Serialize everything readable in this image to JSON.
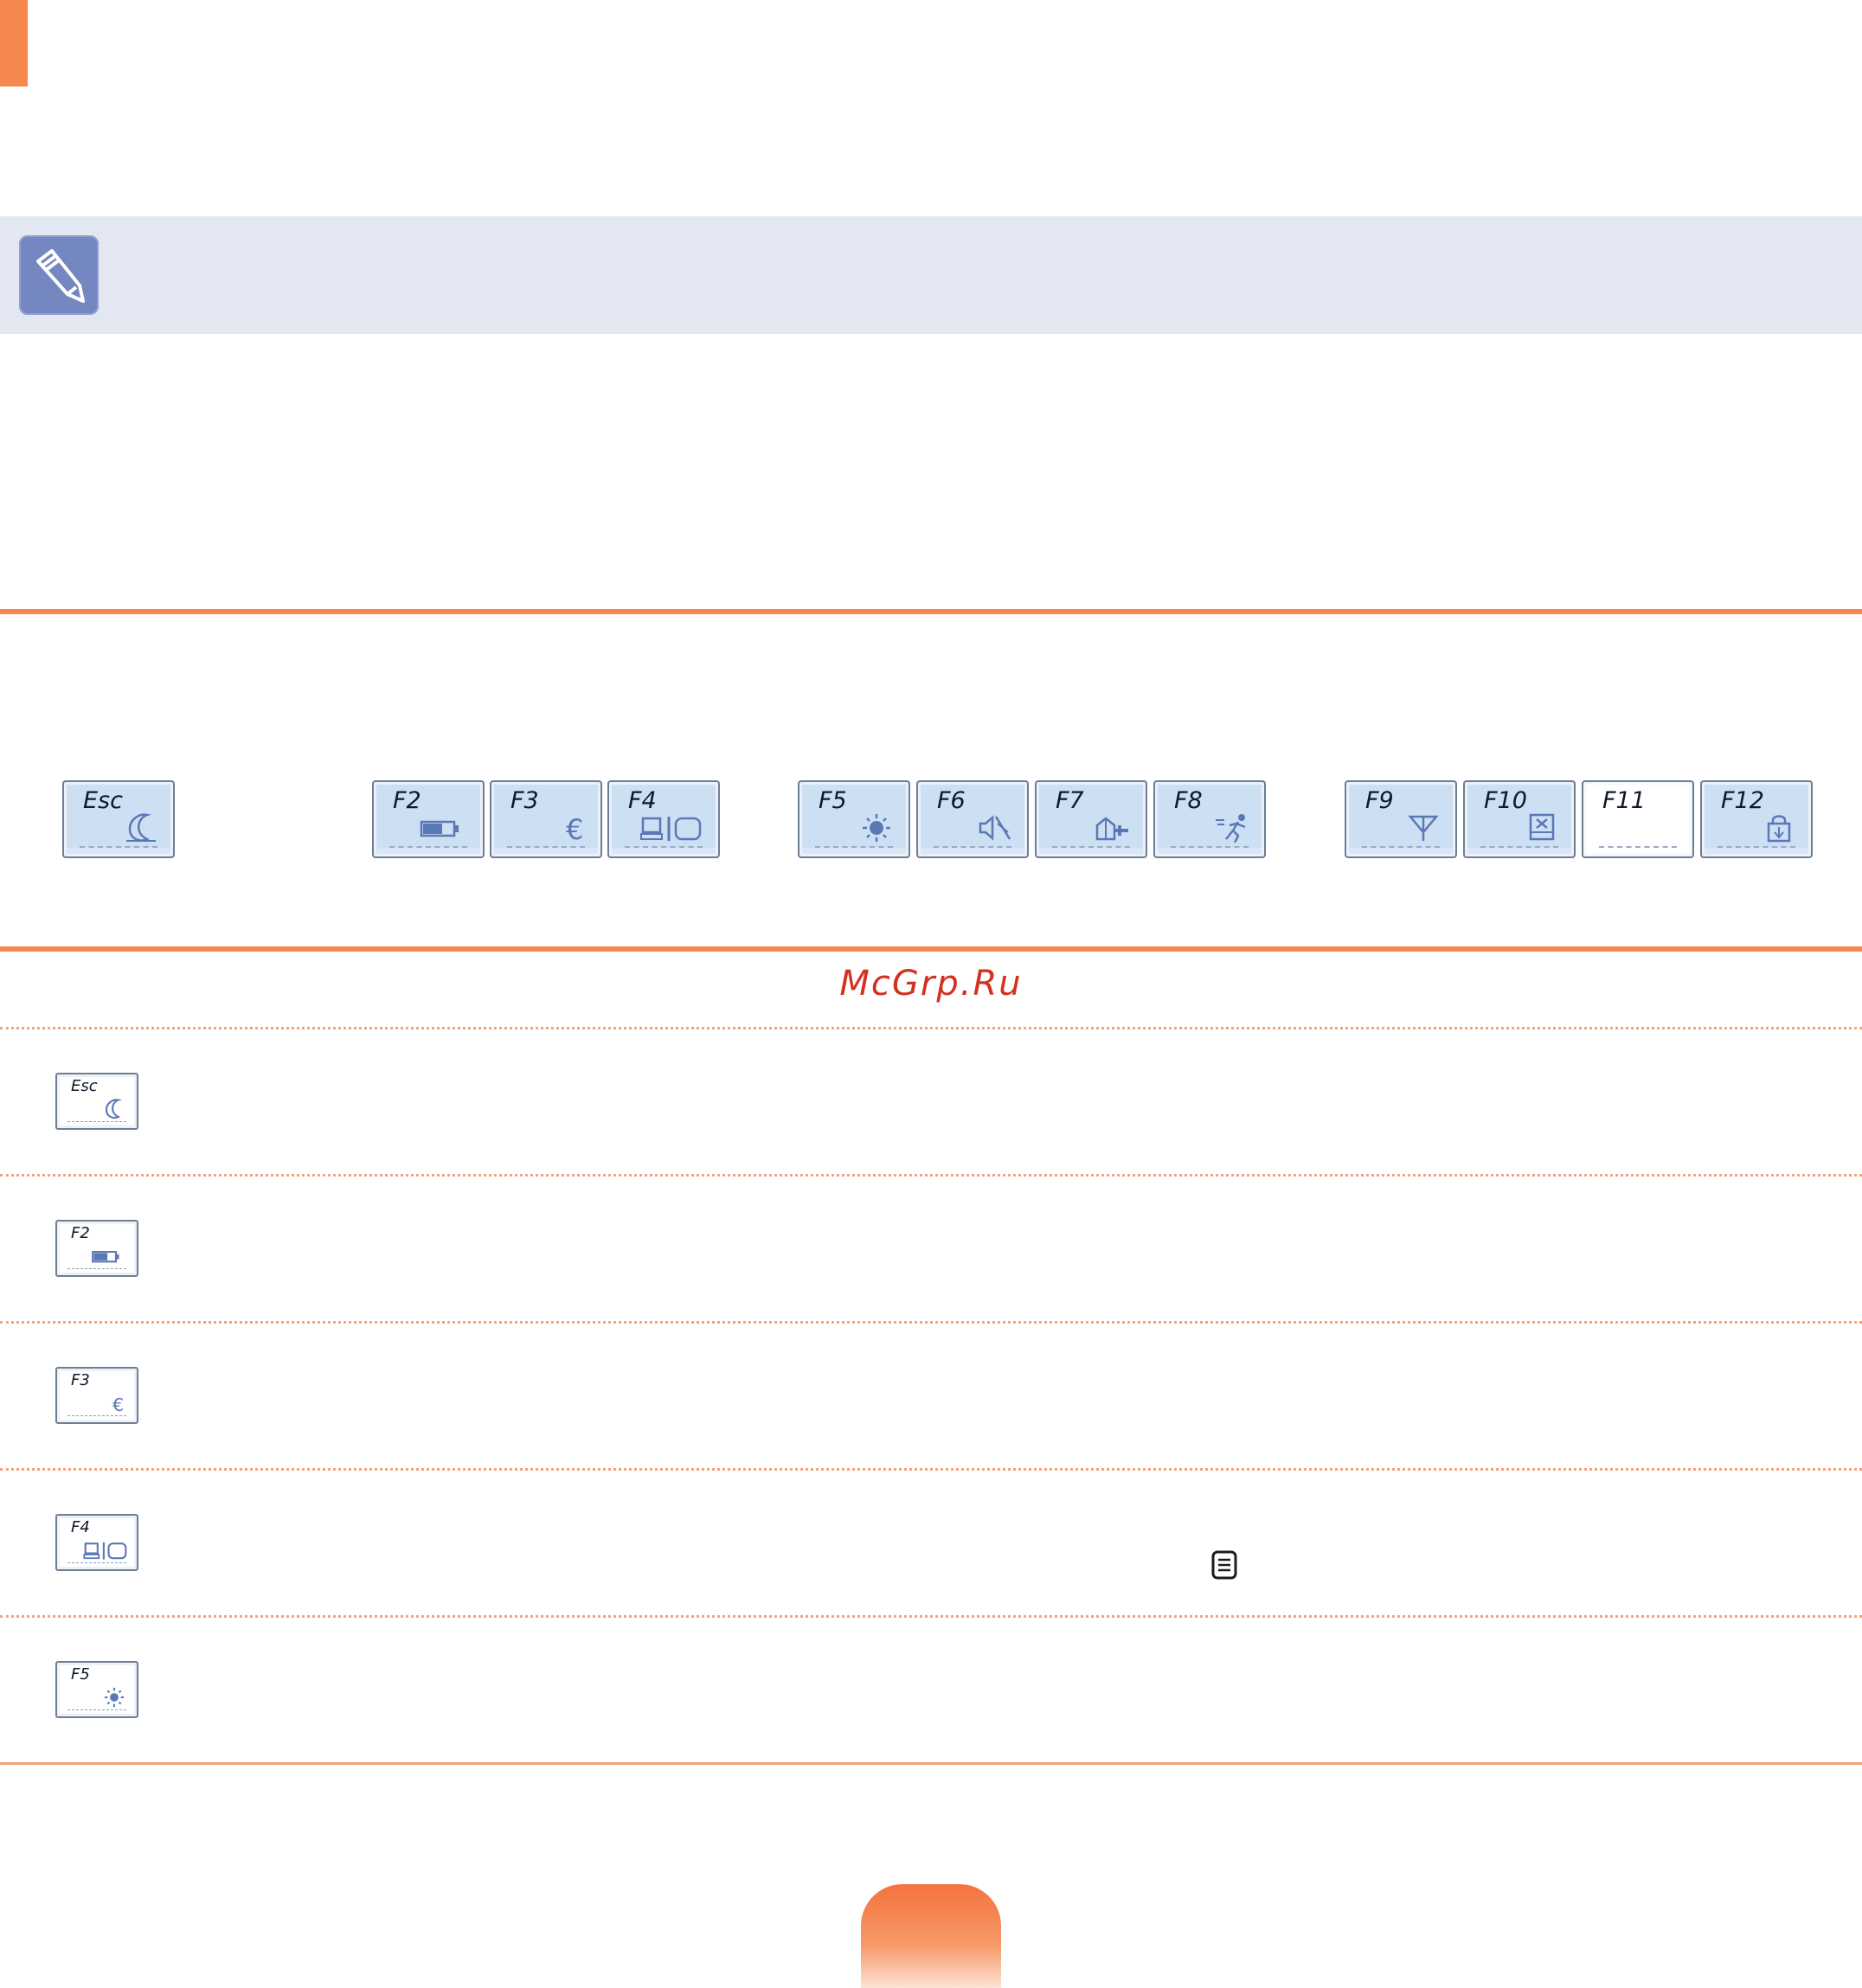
{
  "page": {
    "accent_color": "#f4884f",
    "note_band_color": "#e2e7f1",
    "watermark": "McGrp.Ru"
  },
  "icons": {
    "note": "pencil-note-icon",
    "memo": "memo-icon"
  },
  "keyboard_row": [
    {
      "key": "Esc",
      "icon": "moon-icon"
    },
    {
      "key": "F2",
      "icon": "battery-icon"
    },
    {
      "key": "F3",
      "icon": "euro-icon"
    },
    {
      "key": "F4",
      "icon": "lcd-crt-icon"
    },
    {
      "key": "F5",
      "icon": "brightness-icon"
    },
    {
      "key": "F6",
      "icon": "mute-icon"
    },
    {
      "key": "F7",
      "icon": "play-pause-icon"
    },
    {
      "key": "F8",
      "icon": "runner-icon"
    },
    {
      "key": "F9",
      "icon": "wireless-icon"
    },
    {
      "key": "F10",
      "icon": "touchpad-icon"
    },
    {
      "key": "F11",
      "icon": ""
    },
    {
      "key": "F12",
      "icon": "scroll-lock-icon"
    }
  ],
  "detail_keys": [
    {
      "key": "Esc",
      "icon": "moon-icon"
    },
    {
      "key": "F2",
      "icon": "battery-icon"
    },
    {
      "key": "F3",
      "icon": "euro-icon"
    },
    {
      "key": "F4",
      "icon": "lcd-crt-icon"
    },
    {
      "key": "F5",
      "icon": "brightness-icon"
    }
  ]
}
